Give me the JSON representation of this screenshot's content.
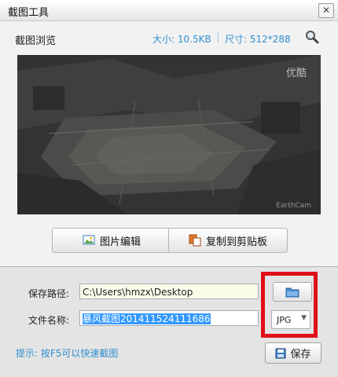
{
  "window": {
    "title": "截图工具",
    "close_glyph": "✕"
  },
  "preview": {
    "label": "截图浏览",
    "size_text": "大小: 10.5KB",
    "dims_text": "尺寸: 512*288",
    "watermark_top": "优酷",
    "watermark_bottom": "EarthCam"
  },
  "actions": {
    "edit_label": "图片编辑",
    "copy_label": "复制到剪贴板"
  },
  "form": {
    "path_label": "保存路径:",
    "path_value": "C:\\Users\\hmzx\\Desktop",
    "name_label": "文件名称:",
    "name_value": "暴风截图201411524111686",
    "format_value": "JPG"
  },
  "hint": "提示: 按F5可以快速截图",
  "save_label": "保存",
  "icons": {
    "search": "search-icon",
    "edit": "image-edit-icon",
    "copy": "copy-icon",
    "folder": "folder-icon",
    "save": "save-icon"
  },
  "colors": {
    "accent_blue": "#2f8fd0",
    "highlight_red": "#e0101a"
  }
}
